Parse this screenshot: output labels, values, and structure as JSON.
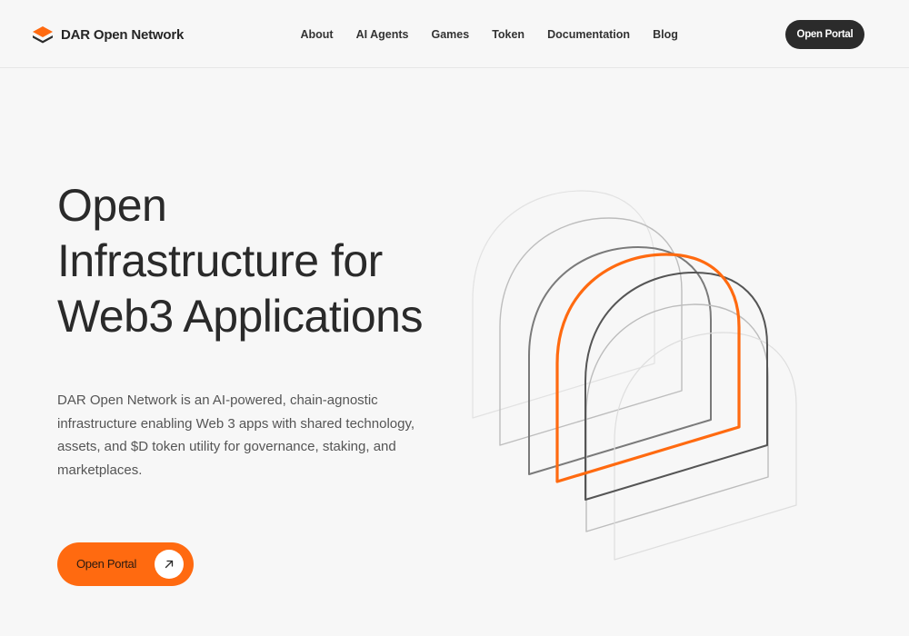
{
  "header": {
    "brand": "DAR Open Network",
    "nav": [
      {
        "label": "About"
      },
      {
        "label": "AI Agents"
      },
      {
        "label": "Games"
      },
      {
        "label": "Token"
      },
      {
        "label": "Documentation"
      },
      {
        "label": "Blog"
      }
    ],
    "cta_label": "Open Portal"
  },
  "hero": {
    "title_lines": [
      "Open",
      "Infrastructure for",
      "Web3 Applications"
    ],
    "description": "DAR Open Network is an AI-powered, chain-agnostic infrastructure enabling Web 3 apps with shared technology, assets, and $D token utility for governance, staking, and marketplaces.",
    "cta_label": "Open Portal",
    "cta_icon": "arrow-up-right-icon"
  },
  "colors": {
    "accent": "#ff6a10",
    "dark": "#2b2b2b",
    "background": "#f7f7f7"
  }
}
